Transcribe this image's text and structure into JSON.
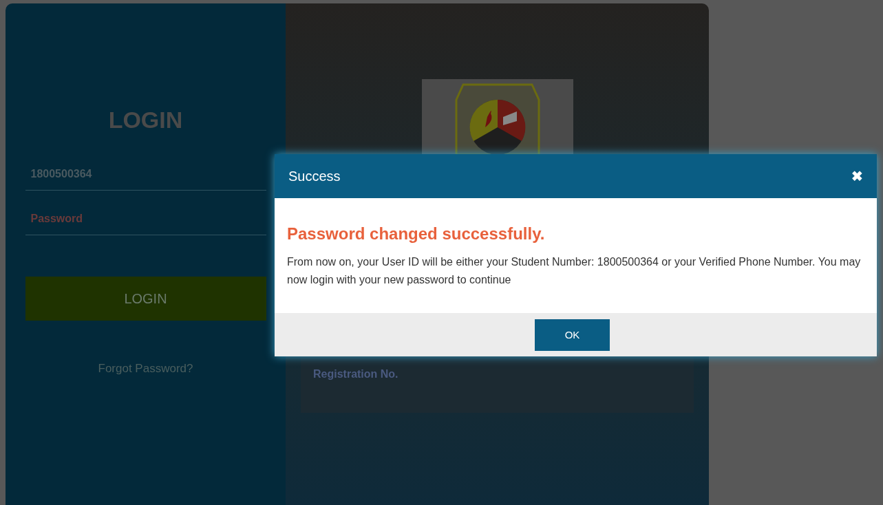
{
  "login": {
    "title": "LOGIN",
    "user_id": {
      "value": "1800500364"
    },
    "password": {
      "placeholder": "Password"
    },
    "button": "LOGIN",
    "forgot_link": "Forgot Password?"
  },
  "info": {
    "note": "Registration No."
  },
  "dialog": {
    "title": "Success",
    "close": "✖",
    "heading": "Password changed successfully.",
    "message": "From now on, your User ID will be either your Student Number: 1800500364 or your Verified Phone Number. You may now login with your new password to continue",
    "ok": "OK"
  }
}
